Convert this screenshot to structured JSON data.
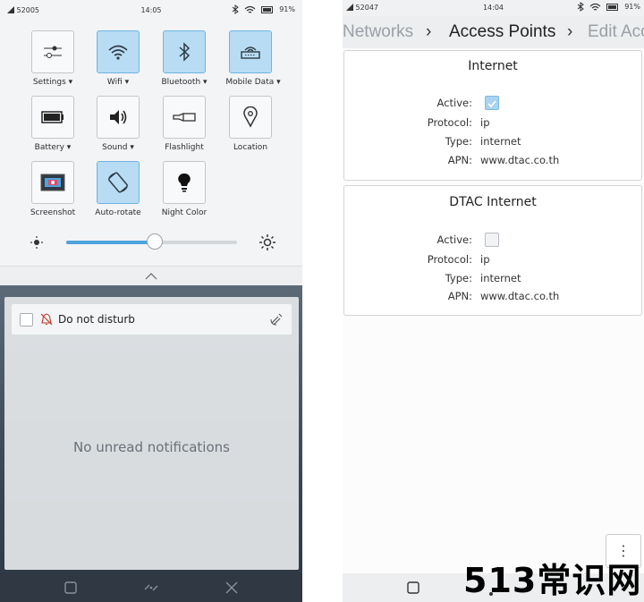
{
  "left": {
    "status": {
      "signal": "52005",
      "time": "14:05",
      "battery": "91%"
    },
    "tiles": [
      {
        "label": "Settings ▾",
        "icon": "settings-icon",
        "on": false
      },
      {
        "label": "Wifi ▾",
        "icon": "wifi-icon",
        "on": true
      },
      {
        "label": "Bluetooth ▾",
        "icon": "bluetooth-icon",
        "on": true
      },
      {
        "label": "Mobile Data ▾",
        "icon": "mobile-data-icon",
        "on": true
      },
      {
        "label": "Battery ▾",
        "icon": "battery-icon",
        "on": false
      },
      {
        "label": "Sound ▾",
        "icon": "sound-icon",
        "on": false
      },
      {
        "label": "Flashlight",
        "icon": "flashlight-icon",
        "on": false
      },
      {
        "label": "Location",
        "icon": "location-icon",
        "on": false
      },
      {
        "label": "Screenshot",
        "icon": "screenshot-icon",
        "on": false
      },
      {
        "label": "Auto-rotate",
        "icon": "auto-rotate-icon",
        "on": true
      },
      {
        "label": "Night Color",
        "icon": "night-color-icon",
        "on": false
      }
    ],
    "brightness": 0.52,
    "dnd_label": "Do not disturb",
    "empty_text": "No unread notifications"
  },
  "right": {
    "status": {
      "signal": "52047",
      "time": "14:04",
      "battery": "91%"
    },
    "crumbs": {
      "first": "Networks",
      "sep": "›",
      "second": "Access Points",
      "third": "Edit Acc"
    },
    "cards": [
      {
        "title": "Internet",
        "active": true,
        "protocol": "ip",
        "type": "internet",
        "apn": "www.dtac.co.th"
      },
      {
        "title": "DTAC Internet",
        "active": false,
        "protocol": "ip",
        "type": "internet",
        "apn": "www.dtac.co.th"
      }
    ],
    "labels": {
      "active": "Active:",
      "protocol": "Protocol:",
      "type": "Type:",
      "apn": "APN:"
    },
    "menu_glyph": "⋮"
  },
  "watermark": "513常识网",
  "colors": {
    "accent": "#4fa3dc",
    "tile_on": "#b8dcf3"
  }
}
